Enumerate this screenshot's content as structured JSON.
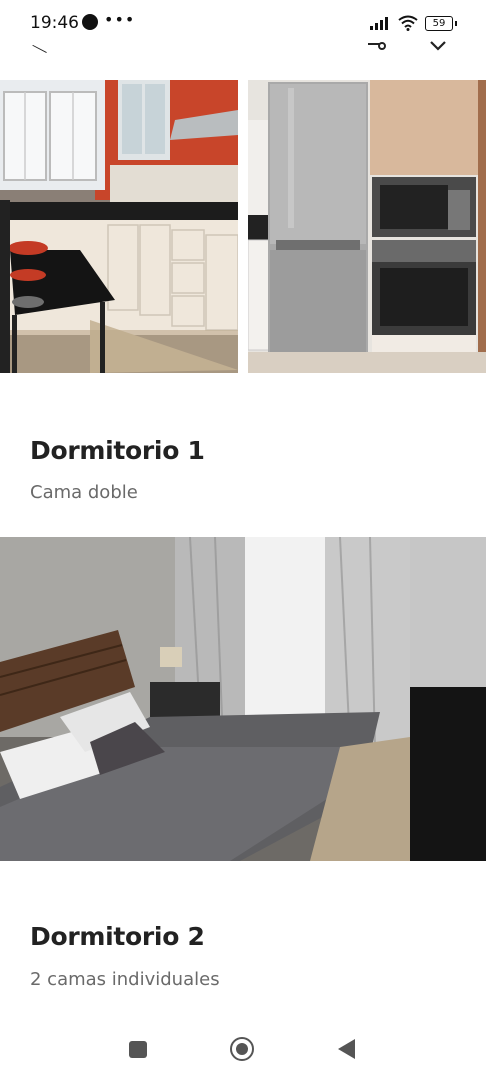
{
  "status_bar": {
    "time": "19:46",
    "dots": "•••",
    "battery": "59",
    "icons": [
      "messenger-icon",
      "signal-icon",
      "wifi-icon",
      "battery-icon"
    ]
  },
  "header": {
    "icons": [
      "back-icon",
      "share-icon",
      "chevron-down-icon"
    ]
  },
  "rooms": [
    {
      "title": "Dormitorio 1",
      "subtitle": "Cama doble"
    },
    {
      "title": "Dormitorio 2",
      "subtitle": "2 camas individuales"
    }
  ],
  "photos": [
    "kitchen-photo-left",
    "kitchen-photo-right",
    "bedroom-photo"
  ],
  "nav_bar": {
    "icons": [
      "recents-button",
      "home-button",
      "back-button"
    ]
  },
  "colors": {
    "title": "#222222",
    "subtitle": "#6a6a6a",
    "nav": "#555555",
    "accent_wall": "#c8452a"
  }
}
